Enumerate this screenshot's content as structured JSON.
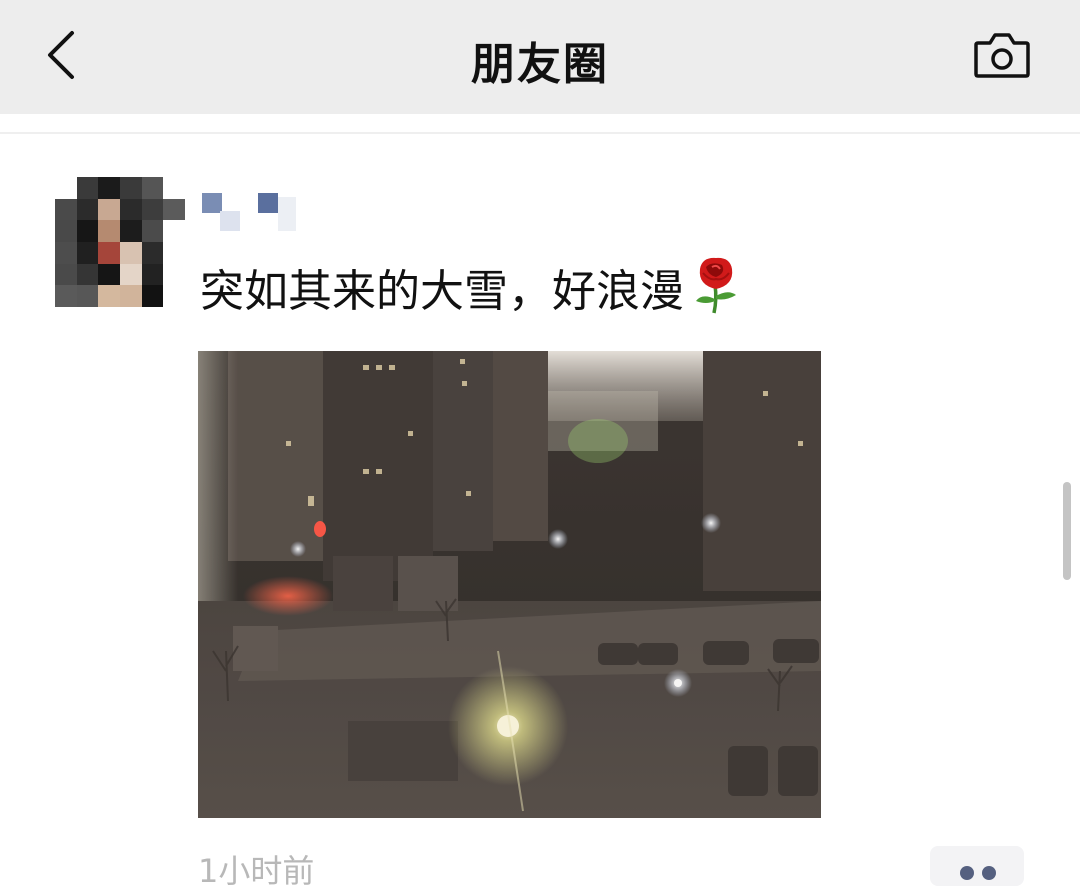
{
  "header": {
    "title": "朋友圈",
    "back_icon": "chevron-left-icon",
    "camera_icon": "camera-icon"
  },
  "post": {
    "text": "突如其来的大雪，好浪漫",
    "emoji": "rose",
    "time": "1小时前",
    "photo_description_icon": "photo-snowy-night"
  },
  "colors": {
    "navbar_bg": "#ededed",
    "text": "#111111",
    "timestamp": "#b8b8b8",
    "more_dots": "#556080"
  }
}
